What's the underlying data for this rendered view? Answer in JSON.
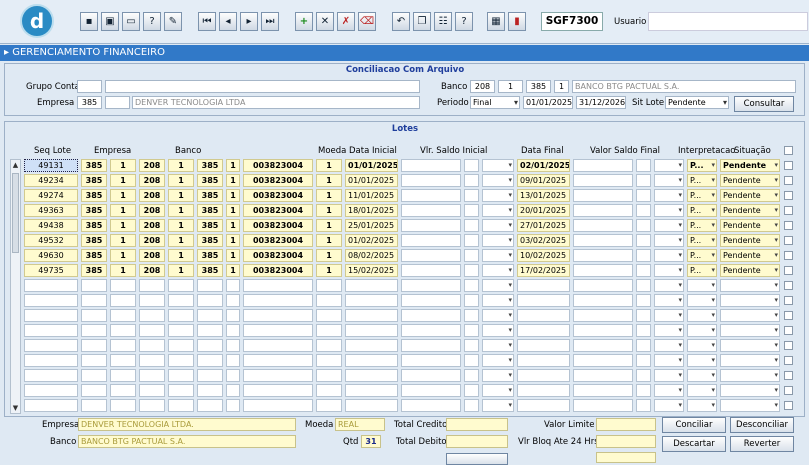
{
  "toolbar": {
    "logo_letter": "d",
    "form_code": "SGF7300",
    "user_label": "Usuario"
  },
  "window_title": "GERENCIAMENTO FINANCEIRO",
  "filter": {
    "section_title": "Conciliacao Com Arquivo",
    "grupo_conta_label": "Grupo Conta",
    "empresa_label": "Empresa",
    "empresa_code": "385",
    "empresa_name": "DENVER TECNOLOGIA LTDA",
    "banco_label": "Banco",
    "banco_code": "208",
    "banco_seq": "1",
    "banco_agencia": "385",
    "banco_digito": "1",
    "banco_name": "BANCO BTG PACTUAL S.A.",
    "periodo_label": "Periodo",
    "periodo_tipo": "Final",
    "periodo_inicio": "01/01/2025",
    "periodo_fim": "31/12/2026",
    "sit_lote_label": "Sit Lote",
    "sit_lote_value": "Pendente",
    "consultar_label": "Consultar"
  },
  "lotes": {
    "section_title": "Lotes",
    "headers": {
      "seq_lote": "Seq Lote",
      "empresa": "Empresa",
      "banco": "Banco",
      "moeda": "Moeda",
      "data_inicial": "Data Inicial",
      "vlr_saldo_inicial": "Vlr. Saldo Inicial",
      "data_final": "Data Final",
      "valor_saldo_final": "Valor Saldo Final",
      "interpretacao": "Interpretacao",
      "situacao": "Situação"
    },
    "rows": [
      {
        "seq": "49131",
        "emp": "385",
        "emp2": "1",
        "banco": "208",
        "b2": "1",
        "b3": "385",
        "b4": "1",
        "conta": "003823004",
        "moeda": "1",
        "data_ini": "01/01/2025",
        "data_fim": "02/01/2025",
        "interp": "P...",
        "situacao": "Pendente"
      },
      {
        "seq": "49234",
        "emp": "385",
        "emp2": "1",
        "banco": "208",
        "b2": "1",
        "b3": "385",
        "b4": "1",
        "conta": "003823004",
        "moeda": "1",
        "data_ini": "01/01/2025",
        "data_fim": "09/01/2025",
        "interp": "P...",
        "situacao": "Pendente"
      },
      {
        "seq": "49274",
        "emp": "385",
        "emp2": "1",
        "banco": "208",
        "b2": "1",
        "b3": "385",
        "b4": "1",
        "conta": "003823004",
        "moeda": "1",
        "data_ini": "11/01/2025",
        "data_fim": "13/01/2025",
        "interp": "P...",
        "situacao": "Pendente"
      },
      {
        "seq": "49363",
        "emp": "385",
        "emp2": "1",
        "banco": "208",
        "b2": "1",
        "b3": "385",
        "b4": "1",
        "conta": "003823004",
        "moeda": "1",
        "data_ini": "18/01/2025",
        "data_fim": "20/01/2025",
        "interp": "P...",
        "situacao": "Pendente"
      },
      {
        "seq": "49438",
        "emp": "385",
        "emp2": "1",
        "banco": "208",
        "b2": "1",
        "b3": "385",
        "b4": "1",
        "conta": "003823004",
        "moeda": "1",
        "data_ini": "25/01/2025",
        "data_fim": "27/01/2025",
        "interp": "P...",
        "situacao": "Pendente"
      },
      {
        "seq": "49532",
        "emp": "385",
        "emp2": "1",
        "banco": "208",
        "b2": "1",
        "b3": "385",
        "b4": "1",
        "conta": "003823004",
        "moeda": "1",
        "data_ini": "01/02/2025",
        "data_fim": "03/02/2025",
        "interp": "P...",
        "situacao": "Pendente"
      },
      {
        "seq": "49630",
        "emp": "385",
        "emp2": "1",
        "banco": "208",
        "b2": "1",
        "b3": "385",
        "b4": "1",
        "conta": "003823004",
        "moeda": "1",
        "data_ini": "08/02/2025",
        "data_fim": "10/02/2025",
        "interp": "P...",
        "situacao": "Pendente"
      },
      {
        "seq": "49735",
        "emp": "385",
        "emp2": "1",
        "banco": "208",
        "b2": "1",
        "b3": "385",
        "b4": "1",
        "conta": "003823004",
        "moeda": "1",
        "data_ini": "15/02/2025",
        "data_fim": "17/02/2025",
        "interp": "P...",
        "situacao": "Pendente"
      }
    ]
  },
  "footer": {
    "empresa_label": "Empresa",
    "empresa_value": "DENVER TECNOLOGIA LTDA.",
    "banco_label": "Banco",
    "banco_value": "BANCO BTG PACTUAL S.A.",
    "moeda_label": "Moeda",
    "moeda_value": "REAL",
    "qtd_label": "Qtd",
    "qtd_value": "31",
    "total_credito_label": "Total Credito",
    "total_debito_label": "Total Debito",
    "valor_limite_label": "Valor Limite",
    "vlr_bloq_label": "Vlr Bloq Ate 24 Hrs",
    "conciliar_label": "Conciliar",
    "desconciliar_label": "Desconciliar",
    "descartar_label": "Descartar",
    "reverter_label": "Reverter"
  }
}
